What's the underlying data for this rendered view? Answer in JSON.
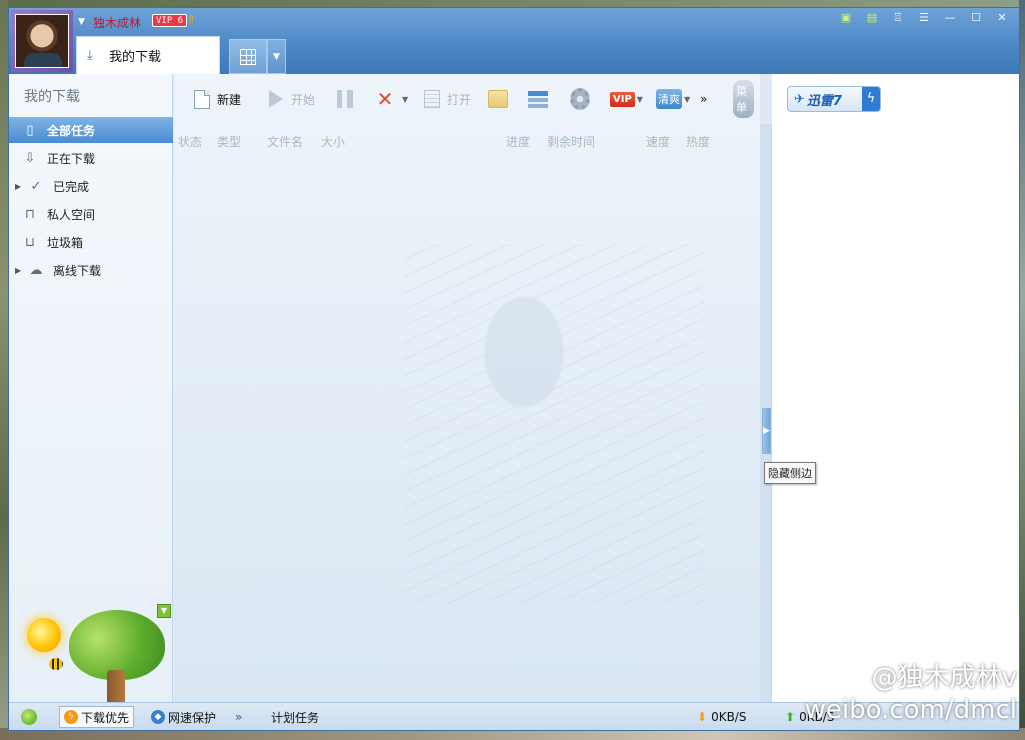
{
  "user": {
    "name": "独木成林",
    "vip_level": "VIP 6"
  },
  "tabs": [
    {
      "label": "我的下载"
    }
  ],
  "sidebar": {
    "title": "我的下载",
    "items": [
      {
        "label": "全部任务",
        "icon": "file-icon",
        "active": true
      },
      {
        "label": "正在下载",
        "icon": "download-arrow-icon"
      },
      {
        "label": "已完成",
        "icon": "check-icon",
        "expandable": true
      },
      {
        "label": "私人空间",
        "icon": "lock-icon"
      },
      {
        "label": "垃圾箱",
        "icon": "trash-icon"
      },
      {
        "label": "离线下载",
        "icon": "cloud-download-icon",
        "expandable": true
      }
    ]
  },
  "toolbar": {
    "new_label": "新建",
    "start_label": "开始",
    "open_label": "打开",
    "vip_label": "VIP",
    "qing_label": "清爽",
    "menu_label": "菜单",
    "more_label": "»"
  },
  "columns": [
    "状态",
    "类型",
    "文件名",
    "大小",
    "进度",
    "剩余时间",
    "速度",
    "热度"
  ],
  "right_panel": {
    "brand": "迅雷7"
  },
  "tooltip": "隐藏侧边",
  "statusbar": {
    "priority_label": "下载优先",
    "protect_label": "网速保护",
    "more_label": "»",
    "schedule_label": "计划任务",
    "down_speed": "0KB/S",
    "up_speed": "0KB/S"
  },
  "watermark": {
    "line1": "@独木成林v",
    "line2": "weibo.com/dmcl"
  },
  "colors": {
    "title_bar": "#4f88c6",
    "accent": "#4a8bd0",
    "username": "#c0172d",
    "vip_badge": "#e83a46"
  }
}
